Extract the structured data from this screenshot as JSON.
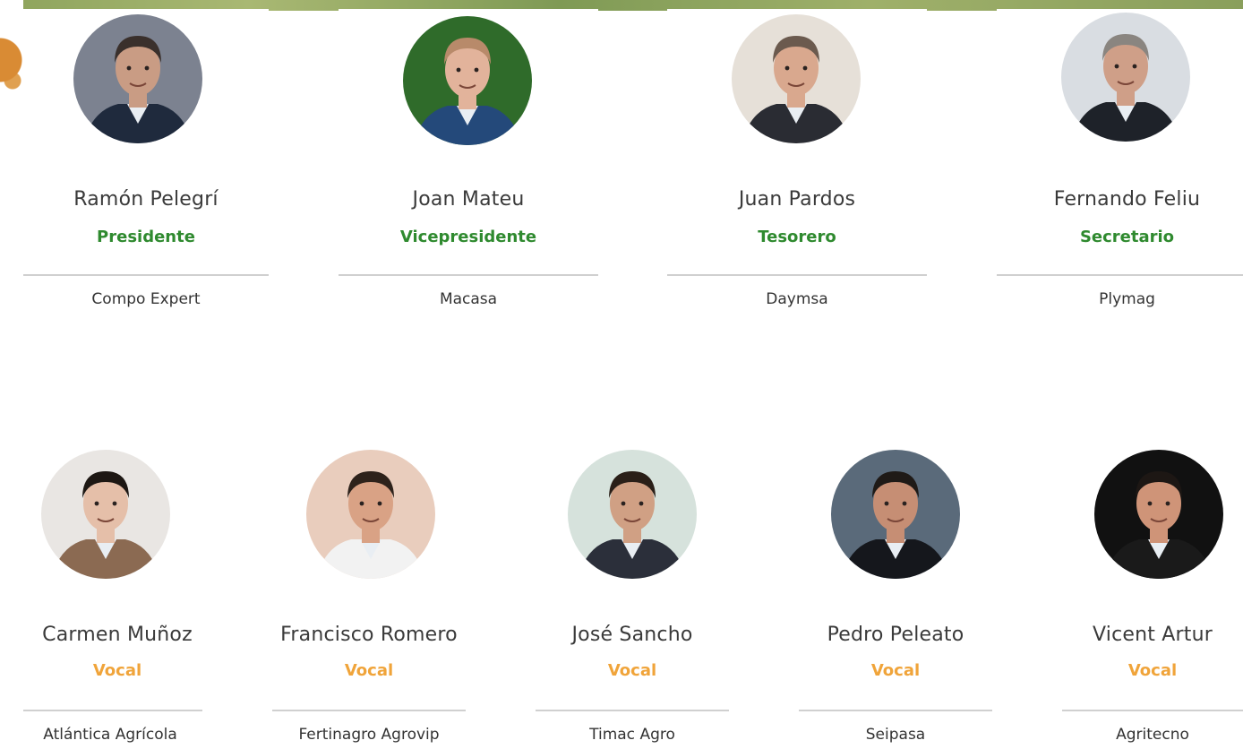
{
  "board": {
    "row1": [
      {
        "name": "Ramón Pelegrí",
        "role": "Presidente",
        "company": "Compo Expert",
        "avatar_bg": "#7c8290",
        "skin": "#c99c84",
        "hair": "#3a302c",
        "suit": "#1f2a3d"
      },
      {
        "name": "Joan Mateu",
        "role": "Vicepresidente",
        "company": "Macasa",
        "avatar_bg": "#2f6b2a",
        "skin": "#e2b39b",
        "hair": "#b88a6a",
        "suit": "#24497a"
      },
      {
        "name": "Juan Pardos",
        "role": "Tesorero",
        "company": "Daymsa",
        "avatar_bg": "#e6e0d8",
        "skin": "#d9a88e",
        "hair": "#6b5a4e",
        "suit": "#2a2c33"
      },
      {
        "name": "Fernando Feliu",
        "role": "Secretario",
        "company": "Plymag",
        "avatar_bg": "#d9dde2",
        "skin": "#cf9f88",
        "hair": "#8a8580",
        "suit": "#1e2229"
      }
    ],
    "row2": [
      {
        "name": "Carmen Muñoz",
        "role": "Vocal",
        "company": "Atlántica Agrícola",
        "avatar_bg": "#e9e6e3",
        "skin": "#e5bfa9",
        "hair": "#1d1713",
        "suit": "#8b6a52"
      },
      {
        "name": "Francisco Romero",
        "role": "Vocal",
        "company": "Fertinagro Agrovip",
        "avatar_bg": "#e9cdbd",
        "skin": "#d9a285",
        "hair": "#2e221b",
        "suit": "#f2f2f2"
      },
      {
        "name": "José Sancho",
        "role": "Vocal",
        "company": "Timac Agro",
        "avatar_bg": "#d6e2dc",
        "skin": "#d0a084",
        "hair": "#2a1f18",
        "suit": "#2b2f3a"
      },
      {
        "name": "Pedro Peleato",
        "role": "Vocal",
        "company": "Seipasa",
        "avatar_bg": "#5a6a7a",
        "skin": "#c68e74",
        "hair": "#1f1a17",
        "suit": "#15171c"
      },
      {
        "name": "Vicent Artur",
        "role": "Vocal",
        "company": "Agritecno",
        "avatar_bg": "#111111",
        "skin": "#cf9478",
        "hair": "#1d1714",
        "suit": "#1a1a1a"
      }
    ]
  },
  "colors": {
    "role_primary": "#2f8a2f",
    "role_vocal": "#f0a43a",
    "divider": "#d0d0d0"
  },
  "icons": {
    "avatar": "person-portrait-icon"
  }
}
